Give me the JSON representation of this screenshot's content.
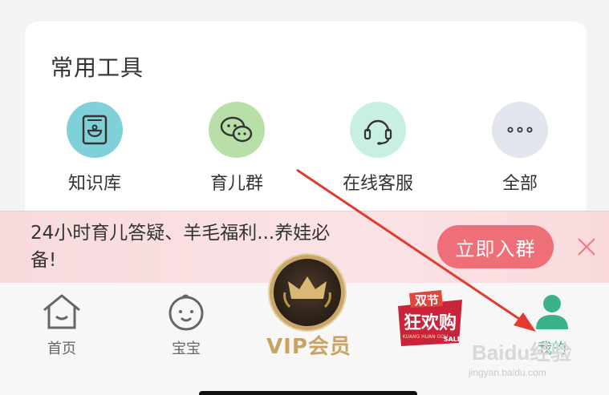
{
  "tools": {
    "title": "常用工具",
    "items": [
      {
        "label": "知识库",
        "icon": "book-icon",
        "color": "#7fd0d8"
      },
      {
        "label": "育儿群",
        "icon": "chat-icon",
        "color": "#b9dfa9"
      },
      {
        "label": "在线客服",
        "icon": "headset-icon",
        "color": "#c9efe4"
      },
      {
        "label": "全部",
        "icon": "more-icon",
        "color": "#e3e5ee"
      }
    ]
  },
  "banner": {
    "text": "24小时育儿答疑、羊毛福利...养娃必备!",
    "button_label": "立即入群",
    "button_color": "#ef6f78"
  },
  "nav": {
    "home_label": "首页",
    "baby_label": "宝宝",
    "vip_label": "VIP会员",
    "promo_text_top": "双节",
    "promo_text_main": "狂欢购",
    "promo_text_sub": "KUANG HUAN GOU",
    "promo_sale": "SALE",
    "me_label": "我的",
    "active_color": "#3cb28b"
  },
  "watermark": {
    "main": "Baidu经验",
    "sub": "jingyan.baidu.com"
  }
}
